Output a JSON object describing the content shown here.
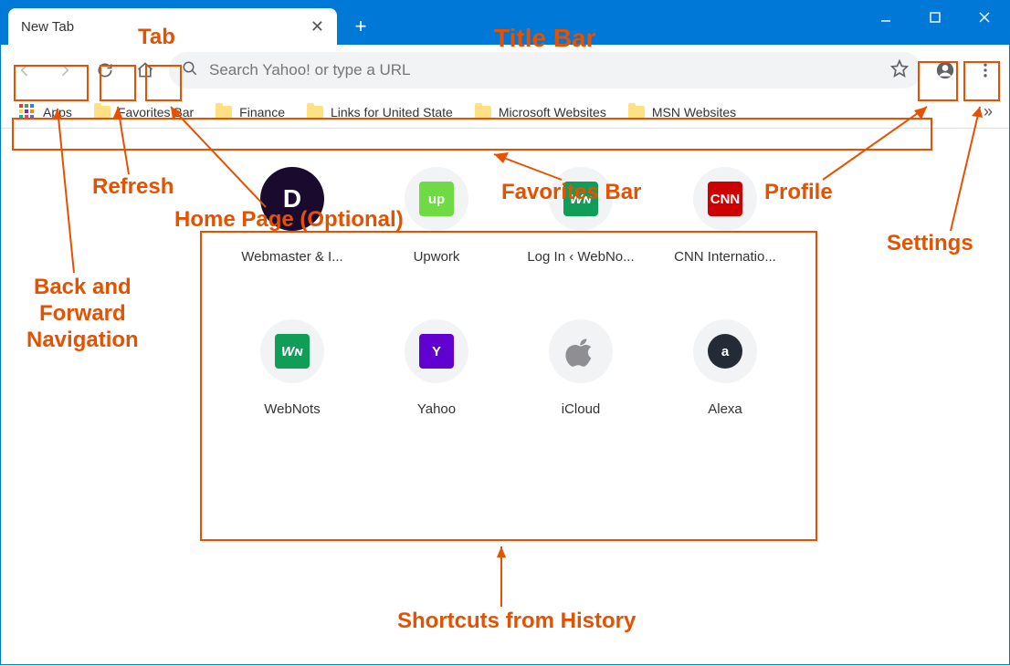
{
  "annotations": {
    "title_bar": "Title Bar",
    "tab": "Tab",
    "back_forward": "Back and\nForward\nNavigation",
    "refresh": "Refresh",
    "home": "Home Page (Optional)",
    "favorites_bar": "Favorites Bar",
    "profile": "Profile",
    "settings": "Settings",
    "shortcuts": "Shortcuts from History"
  },
  "tab": {
    "title": "New Tab"
  },
  "toolbar": {
    "search_placeholder": "Search Yahoo! or type a URL"
  },
  "bookmarks": {
    "apps_label": "Apps",
    "items": [
      "Favorites Bar",
      "Finance",
      "Links for United State",
      "Microsoft Websites",
      "MSN Websites"
    ]
  },
  "shortcuts": [
    {
      "label": "Webmaster & I...",
      "icon_text": "D",
      "bg": "#1a0b2e",
      "fg": "#ffffff",
      "full_circle": true
    },
    {
      "label": "Upwork",
      "icon_text": "up",
      "bg": "#6fda44",
      "fg": "#ffffff"
    },
    {
      "label": "Log In ‹ WebNo...",
      "icon_text": "Wɴ",
      "bg": "#0f9d58",
      "fg": "#ffffff",
      "italic": true
    },
    {
      "label": "CNN Internatio...",
      "icon_text": "CNN",
      "bg": "#cc0000",
      "fg": "#ffffff"
    },
    {
      "label": "WebNots",
      "icon_text": "Wɴ",
      "bg": "#0f9d58",
      "fg": "#ffffff",
      "italic": true
    },
    {
      "label": "Yahoo",
      "icon_text": "Y",
      "bg": "#6001d2",
      "fg": "#ffffff"
    },
    {
      "label": "iCloud",
      "icon_text": "",
      "bg": "transparent",
      "fg": "#8e8e93",
      "apple": true
    },
    {
      "label": "Alexa",
      "icon_text": "a",
      "bg": "#222b36",
      "fg": "#ffffff",
      "round": true
    }
  ]
}
